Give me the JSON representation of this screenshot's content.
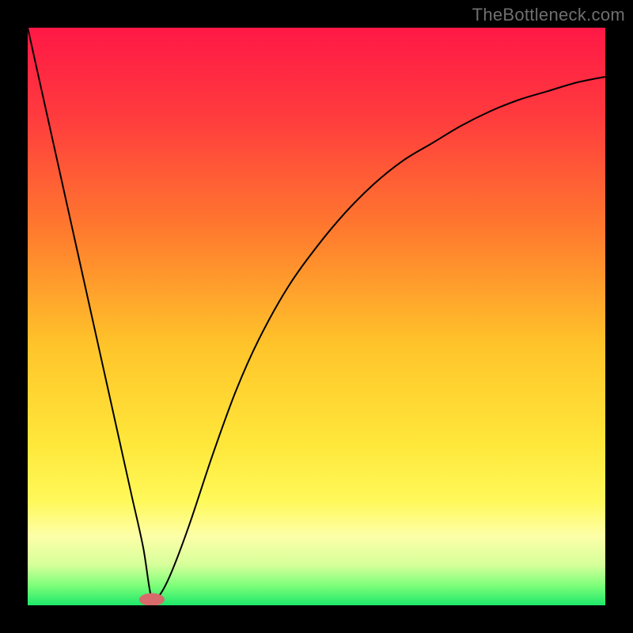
{
  "watermark": "TheBottleneck.com",
  "gradient_stops": [
    {
      "offset": 0.0,
      "color": "#ff1846"
    },
    {
      "offset": 0.15,
      "color": "#ff3a3e"
    },
    {
      "offset": 0.35,
      "color": "#ff7a2e"
    },
    {
      "offset": 0.55,
      "color": "#ffc42a"
    },
    {
      "offset": 0.72,
      "color": "#ffe73a"
    },
    {
      "offset": 0.82,
      "color": "#fff95a"
    },
    {
      "offset": 0.88,
      "color": "#fdffa8"
    },
    {
      "offset": 0.93,
      "color": "#d6ff9a"
    },
    {
      "offset": 0.965,
      "color": "#7fff7a"
    },
    {
      "offset": 1.0,
      "color": "#1ee86a"
    }
  ],
  "chart_data": {
    "type": "line",
    "title": "",
    "xlabel": "",
    "ylabel": "",
    "xlim": [
      0,
      100
    ],
    "ylim": [
      0,
      100
    ],
    "legend": false,
    "grid": false,
    "note": "Values read from the rendered curve; x is percent across plot width, y is curve height as percent of plot height (0 = bottom).",
    "series": [
      {
        "name": "curve",
        "x": [
          0,
          2,
          4,
          6,
          8,
          10,
          12,
          14,
          16,
          18,
          20,
          21.5,
          23,
          25,
          28,
          32,
          36,
          40,
          45,
          50,
          55,
          60,
          65,
          70,
          75,
          80,
          85,
          90,
          95,
          100
        ],
        "y": [
          100,
          91,
          82,
          73,
          64,
          55,
          46,
          37,
          28,
          19,
          10,
          1,
          2,
          6,
          14,
          26,
          37,
          46,
          55,
          62,
          68,
          73,
          77,
          80,
          83,
          85.5,
          87.5,
          89,
          90.5,
          91.5
        ]
      }
    ],
    "marker": {
      "x": 21.5,
      "y": 1,
      "rx": 2.2,
      "ry": 1.1,
      "color": "#d76a6a"
    }
  }
}
